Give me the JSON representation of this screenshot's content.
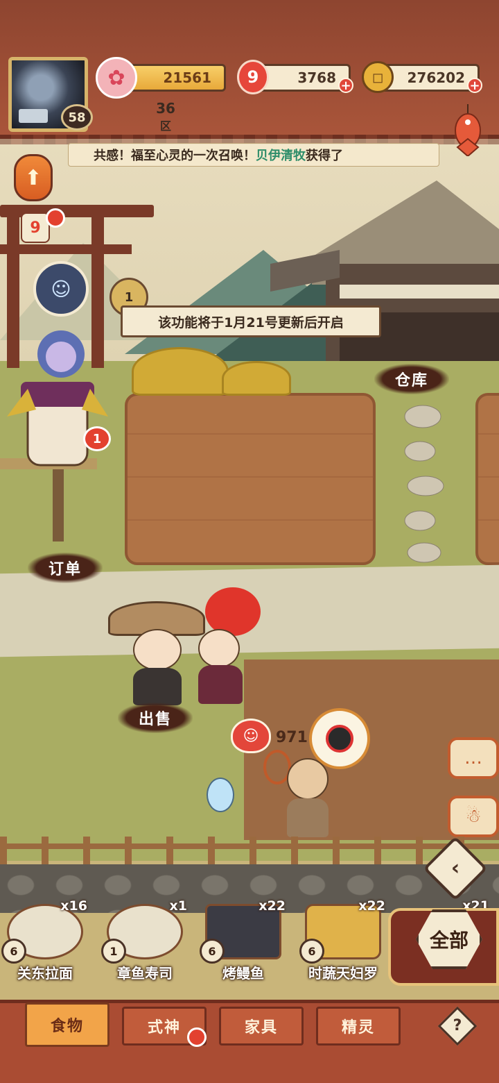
{
  "hud": {
    "level": "58",
    "sakura_value": "21561",
    "jade_value": "3768",
    "coin_value": "276202",
    "server_number": "36",
    "server_suffix": "区"
  },
  "marquee": {
    "prefix": "共感！福至心灵的一次召唤！",
    "player": "贝伊清牧",
    "suffix": "获得了"
  },
  "notice": {
    "tag": "1",
    "text": "该功能将于1月21号更新后开启"
  },
  "badges": {
    "scarecrow_count": "1"
  },
  "scene_labels": {
    "warehouse": "仓库",
    "orders": "订单",
    "sell": "出售"
  },
  "heart_count": "971",
  "inventory": [
    {
      "name": "关东拉面",
      "qty": "x16",
      "level": "6"
    },
    {
      "name": "章鱼寿司",
      "qty": "x1",
      "level": "1"
    },
    {
      "name": "烤鳗鱼",
      "qty": "x22",
      "level": "6"
    },
    {
      "name": "时蔬天妇罗",
      "qty": "x22",
      "level": "6"
    },
    {
      "name": "",
      "qty": "x21",
      "level": ""
    }
  ],
  "all_button": "全部",
  "tabs": [
    {
      "label": "食物",
      "active": true
    },
    {
      "label": "式神",
      "active": false
    },
    {
      "label": "家具",
      "active": false
    },
    {
      "label": "精灵",
      "active": false
    }
  ],
  "help": "?",
  "colors": {
    "accent_red": "#e3412f",
    "hud_brown": "#8e4530",
    "gold": "#f2a449"
  },
  "icons": [
    "sakura-icon",
    "jade-magatama-icon",
    "coin-icon",
    "fish-streamer-icon",
    "arrow-up-icon",
    "chat-icon",
    "spirit-icon",
    "back-chevron-icon",
    "heart-icon",
    "ladybug-icon",
    "help-icon"
  ]
}
